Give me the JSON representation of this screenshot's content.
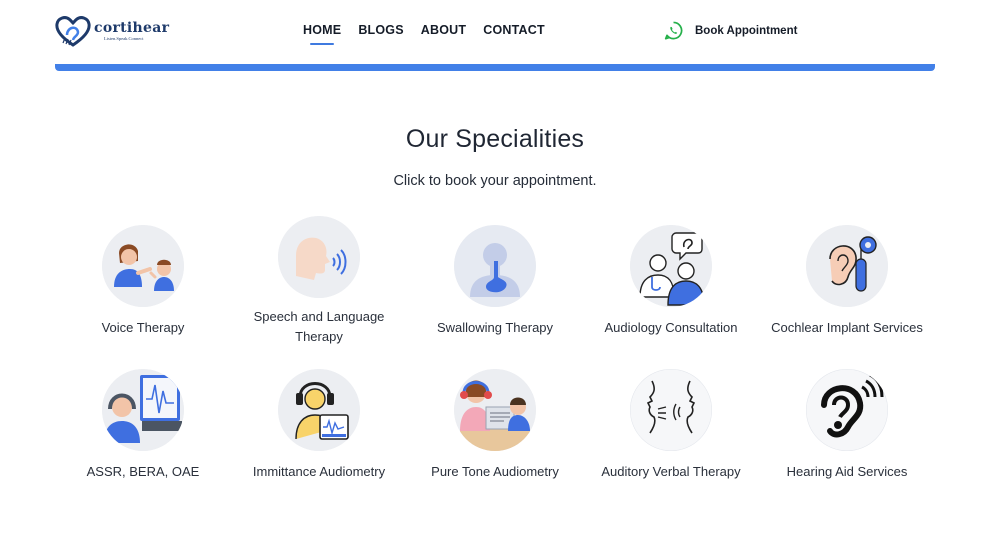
{
  "brand": {
    "name": "cortihear",
    "tagline": "Listen.Speak.Connect"
  },
  "nav": {
    "items": [
      {
        "label": "HOME",
        "active": true
      },
      {
        "label": "BLOGS",
        "active": false
      },
      {
        "label": "ABOUT",
        "active": false
      },
      {
        "label": "CONTACT",
        "active": false
      }
    ]
  },
  "cta": {
    "label": "Book Appointment",
    "icon": "whatsapp-icon"
  },
  "colors": {
    "accent": "#4280e8",
    "text": "#1f2633",
    "icon_bg": "#eceef2",
    "whatsapp": "#25b04a"
  },
  "specialities": {
    "title": "Our Specialities",
    "subtitle": "Click to book your appointment.",
    "items": [
      {
        "label": "Voice Therapy",
        "icon": "voice-therapy-icon"
      },
      {
        "label": "Speech and Language Therapy",
        "icon": "speech-language-icon"
      },
      {
        "label": "Swallowing Therapy",
        "icon": "swallowing-icon"
      },
      {
        "label": "Audiology Consultation",
        "icon": "audiology-consultation-icon"
      },
      {
        "label": "Cochlear Implant Services",
        "icon": "cochlear-implant-icon"
      },
      {
        "label": "ASSR, BERA, OAE",
        "icon": "assr-bera-oae-icon"
      },
      {
        "label": "Immittance Audiometry",
        "icon": "immittance-audiometry-icon"
      },
      {
        "label": "Pure Tone Audiometry",
        "icon": "pure-tone-audiometry-icon"
      },
      {
        "label": "Auditory Verbal Therapy",
        "icon": "auditory-verbal-icon"
      },
      {
        "label": "Hearing Aid Services",
        "icon": "hearing-aid-icon"
      }
    ]
  }
}
